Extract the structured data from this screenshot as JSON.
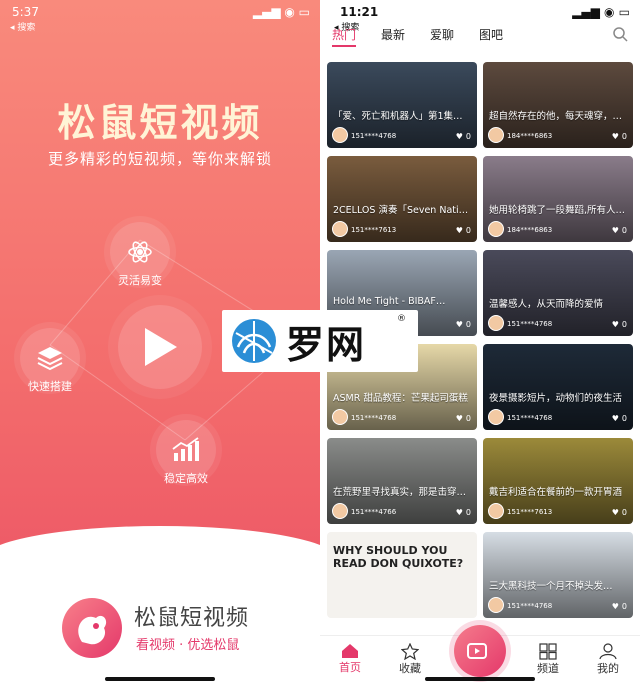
{
  "left": {
    "status_time": "5:37",
    "back_label": "◂ 搜索",
    "title": "松鼠短视频",
    "subtitle": "更多精彩的短视频，等你来解锁",
    "features": [
      "灵活易变",
      "快速搭建",
      "稳定高效"
    ],
    "brand_name": "松鼠短视频",
    "slogan": "看视频 · 优选松鼠"
  },
  "right": {
    "status_time": "11:21",
    "back_label": "◂ 搜索",
    "tabs": [
      "热门",
      "最新",
      "爱聊",
      "图吧"
    ],
    "cards": [
      {
        "caption": "「爱、死亡和机器人」第1集…",
        "user": "151****4768",
        "likes": "0",
        "bg": "#3b4a5c"
      },
      {
        "caption": "超自然存在的他，每天魂穿，…",
        "user": "184****6863",
        "likes": "0",
        "bg": "#5d4a3e"
      },
      {
        "caption": "2CELLOS 演奏「Seven Nati…",
        "user": "151****7613",
        "likes": "0",
        "bg": "#7a5c3e"
      },
      {
        "caption": "她用轮椅跳了一段舞蹈,所有人…",
        "user": "184****6863",
        "likes": "0",
        "bg": "#8a7c8a"
      },
      {
        "caption": "Hold Me Tight - BIBAF…",
        "user": "151****4768",
        "likes": "0",
        "bg": "#9aa6b4"
      },
      {
        "caption": "温馨感人，从天而降的爱情",
        "user": "151****4768",
        "likes": "0",
        "bg": "#4a4a5a"
      },
      {
        "caption": "ASMR 甜品教程：芒果起司蛋糕",
        "user": "151****4768",
        "likes": "0",
        "bg": "#e6d8a8"
      },
      {
        "caption": "夜景摄影短片，动物们的夜生活",
        "user": "151****4768",
        "likes": "0",
        "bg": "#1e2a38"
      },
      {
        "caption": "在荒野里寻找真实，那是击穿…",
        "user": "151****4766",
        "likes": "0",
        "bg": "#8a8c8a"
      },
      {
        "caption": "戴吉利适合在餐前的一款开胃酒",
        "user": "151****7613",
        "likes": "0",
        "bg": "#9c8a3a"
      },
      {
        "caption": "WHY SHOULD YOU READ DON QUIXOTE?",
        "user": "",
        "likes": "",
        "bg": "#f4f2ee"
      },
      {
        "caption": "三大黑科技一个月不掉头发…",
        "user": "151****4768",
        "likes": "0",
        "bg": "#d6dde4"
      }
    ],
    "tabbar": [
      "首页",
      "收藏",
      "频道",
      "我的"
    ]
  },
  "watermark": {
    "text": "罗网",
    "reg": "®"
  }
}
